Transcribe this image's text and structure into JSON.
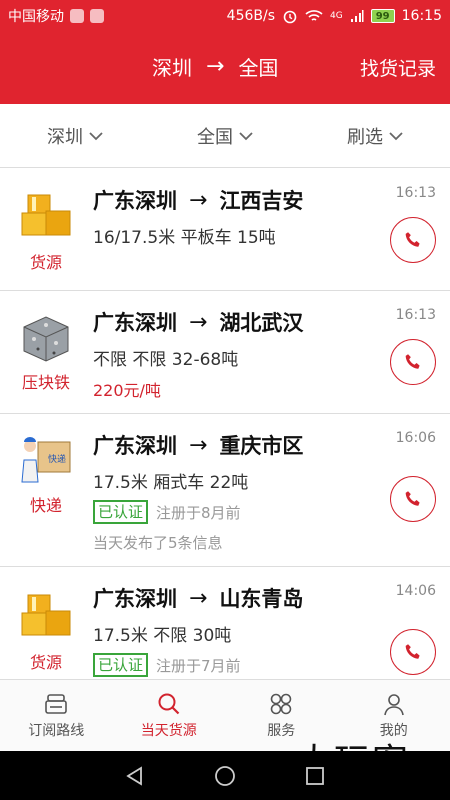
{
  "status_bar": {
    "carrier": "中国移动",
    "net_speed": "456B/s",
    "network": "4G",
    "battery": "99",
    "time": "16:15"
  },
  "header": {
    "from": "深圳",
    "arrow": "→",
    "to": "全国",
    "history_label": "找货记录"
  },
  "filters": {
    "origin": "深圳",
    "destination": "全国",
    "filter": "刷选"
  },
  "list": {
    "items": [
      {
        "category": "货源",
        "thumb_icon": "boxes-icon",
        "from": "广东深圳",
        "arrow": "→",
        "to": "江西吉安",
        "spec": "16/17.5米 平板车 15吨",
        "time": "16:13"
      },
      {
        "category": "压块铁",
        "thumb_icon": "scrap-block-icon",
        "from": "广东深圳",
        "arrow": "→",
        "to": "湖北武汉",
        "spec": "不限 不限 32-68吨",
        "price": "220元/吨",
        "time": "16:13"
      },
      {
        "category": "快递",
        "thumb_icon": "courier-icon",
        "from": "广东深圳",
        "arrow": "→",
        "to": "重庆市区",
        "spec": "17.5米 厢式车 22吨",
        "badge": "已认证",
        "registered": "注册于8月前",
        "published": "当天发布了5条信息",
        "time": "16:06"
      },
      {
        "category": "货源",
        "thumb_icon": "boxes-icon",
        "from": "广东深圳",
        "arrow": "→",
        "to": "山东青岛",
        "spec": "17.5米 不限 30吨",
        "badge": "已认证",
        "registered": "注册于7月前",
        "time": "14:06"
      }
    ]
  },
  "tabbar": {
    "tabs": [
      {
        "label": "订阅路线",
        "icon": "subscribe-icon"
      },
      {
        "label": "当天货源",
        "icon": "search-icon",
        "active": true
      },
      {
        "label": "服务",
        "icon": "services-icon"
      },
      {
        "label": "我的",
        "icon": "profile-icon"
      }
    ]
  },
  "watermark": "大玩客",
  "colors": {
    "brand_red": "#e0242f",
    "accent_red": "#d2232e",
    "verified_green": "#39a53a"
  }
}
